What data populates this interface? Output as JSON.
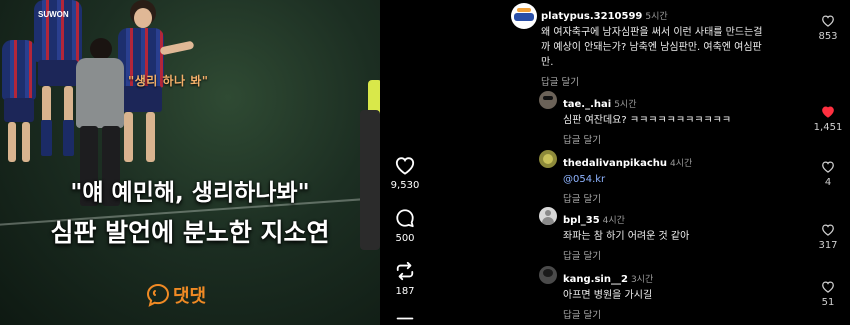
{
  "video": {
    "caption_small": "\"생리 하나 봐\"",
    "quote": "\"얘 예민해, 생리하나봐\"",
    "subtitle": "심판 발언에 분노한 지소연",
    "logo_text": "댓댓",
    "jersey_text": "SUWON"
  },
  "actions": {
    "likes": "9,530",
    "comments": "500",
    "reposts": "187"
  },
  "comments": [
    {
      "username": "platypus.3210599",
      "time": "5시간",
      "lines": [
        "왜 여자축구에 남자심판을 써서 이런 사태를 만드는걸",
        "까 예상이 안돼는가? 남축엔 남심판만. 여축엔 여심판",
        "만."
      ],
      "reply": "답글 달기",
      "likes": "853",
      "liked": false
    },
    {
      "username": "tae._.hai",
      "time": "5시간",
      "lines": [
        "심판 여잔데요? ㅋㅋㅋㅋㅋㅋㅋㅋㅋㅋㅋ"
      ],
      "reply": "답글 달기",
      "likes": "1,451",
      "liked": true
    },
    {
      "username": "thedalivanpikachu",
      "time": "4시간",
      "lines": [
        "@054.kr"
      ],
      "reply": "답글 달기",
      "likes": "4",
      "liked": false
    },
    {
      "username": "bpl_35",
      "time": "4시간",
      "lines": [
        "좌파는 참 하기 어려운 것 같아"
      ],
      "reply": "답글 달기",
      "likes": "317",
      "liked": false
    },
    {
      "username": "kang.sin__2",
      "time": "3시간",
      "lines": [
        "아프면 병원을 가시길"
      ],
      "reply": "답글 달기",
      "likes": "51",
      "liked": false
    }
  ],
  "colors": {
    "accent_like": "#ff3040",
    "link": "#8fb4ff",
    "logo": "#f08a24"
  }
}
